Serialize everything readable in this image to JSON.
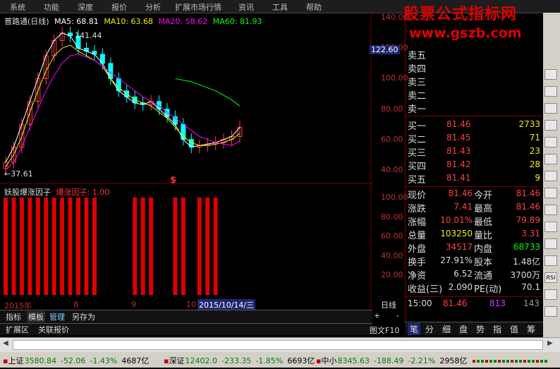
{
  "menu": [
    "系统",
    "功能",
    "深度",
    "报价",
    "分析",
    "扩展市场行情",
    "资讯",
    "工具",
    "帮助"
  ],
  "watermark": {
    "line1": "股票公式指标网",
    "line2": "www.gszb.com"
  },
  "chart": {
    "stock_name": "普路通(日线)",
    "ma5": "MA5: 68.81",
    "ma10": "MA10: 63.68",
    "ma20": "MA20: 58.62",
    "ma60": "MA60: 81.93",
    "high_label": "141.44",
    "low_label": "←37.61",
    "cursor_price": "122.60",
    "signal_mark": "$",
    "colors": {
      "ma5": "#ffffff",
      "ma10": "#f0f000",
      "ma20": "#ff00ff",
      "ma60": "#00ff00",
      "up": "#ff4040",
      "down": "#00ffff"
    }
  },
  "indicator": {
    "name": "妖股爆涨因子",
    "line": "爆涨因子: 1.00"
  },
  "x_axis": {
    "year": "2015年",
    "m8": "8",
    "m9": "9",
    "m10": "10",
    "date_box": "2015/10/14/三"
  },
  "chart_data": [
    {
      "type": "line",
      "title": "普路通(日线)",
      "y_ticks": [
        "140.00",
        "120.00",
        "100.00",
        "80.00",
        "60.00",
        "40.00"
      ],
      "ylim": [
        37.61,
        141.44
      ],
      "series": [
        {
          "name": "MA5",
          "values": [
            45,
            55,
            70,
            85,
            100,
            115,
            125,
            130,
            128,
            120,
            118,
            116,
            110,
            100,
            92,
            88,
            84,
            83,
            85,
            80,
            75,
            70,
            60,
            55,
            56,
            57,
            58,
            60,
            62,
            68
          ]
        },
        {
          "name": "MA10",
          "values": [
            42,
            50,
            62,
            78,
            92,
            105,
            115,
            120,
            122,
            118,
            115,
            112,
            108,
            100,
            94,
            90,
            86,
            84,
            82,
            78,
            74,
            68,
            62,
            58,
            56,
            56,
            57,
            58,
            60,
            64
          ]
        },
        {
          "name": "MA20",
          "values": [
            40,
            45,
            55,
            68,
            80,
            92,
            102,
            110,
            115,
            116,
            114,
            112,
            108,
            104,
            100,
            96,
            92,
            88,
            85,
            82,
            78,
            74,
            70,
            66,
            62,
            60,
            58,
            57,
            56,
            59
          ]
        },
        {
          "name": "MA60",
          "values": [
            null,
            null,
            null,
            null,
            null,
            null,
            null,
            null,
            null,
            null,
            null,
            null,
            null,
            null,
            null,
            null,
            null,
            null,
            null,
            null,
            null,
            100,
            99,
            98,
            96,
            94,
            92,
            89,
            86,
            82
          ]
        }
      ],
      "grid": false
    },
    {
      "type": "bar",
      "title": "妖股爆涨因子",
      "y_ticks": [
        "100.00",
        "80.00",
        "60.00",
        "40.00",
        "20.00"
      ],
      "ylim": [
        0,
        100
      ],
      "values": [
        1,
        1,
        1,
        1,
        1,
        1,
        1,
        1,
        1,
        1,
        1,
        1,
        0,
        0,
        0,
        0,
        1,
        1,
        1,
        0,
        0,
        1,
        1,
        0,
        1,
        1,
        1,
        0,
        0,
        0
      ]
    }
  ],
  "orderbook": {
    "sell": [
      "卖五",
      "卖四",
      "卖三",
      "卖二",
      "卖一"
    ],
    "buy": [
      {
        "label": "买一",
        "price": "81.46",
        "vol": "2733"
      },
      {
        "label": "买二",
        "price": "81.45",
        "vol": "71"
      },
      {
        "label": "买三",
        "price": "81.43",
        "vol": "23"
      },
      {
        "label": "买四",
        "price": "81.42",
        "vol": "28"
      },
      {
        "label": "买五",
        "price": "81.41",
        "vol": "9"
      }
    ]
  },
  "quote": [
    {
      "l1": "现价",
      "v1": "81.46",
      "c1": "#ff4040",
      "l2": "今开",
      "v2": "81.46",
      "c2": "#ff4040"
    },
    {
      "l1": "涨跌",
      "v1": "7.41",
      "c1": "#ff4040",
      "l2": "最高",
      "v2": "81.46",
      "c2": "#ff4040"
    },
    {
      "l1": "涨幅",
      "v1": "10.01%",
      "c1": "#ff4040",
      "l2": "最低",
      "v2": "79.89",
      "c2": "#ff4040"
    },
    {
      "l1": "总量",
      "v1": "103250",
      "c1": "#f0f000",
      "l2": "量比",
      "v2": "3.31",
      "c2": "#ff4040"
    },
    {
      "l1": "外盘",
      "v1": "34517",
      "c1": "#ff4040",
      "l2": "内盘",
      "v2": "68733",
      "c2": "#00ff00"
    },
    {
      "l1": "换手",
      "v1": "27.91%",
      "c1": "#dcdcdc",
      "l2": "股本",
      "v2": "1.48亿",
      "c2": "#dcdcdc"
    },
    {
      "l1": "净资",
      "v1": "6.52",
      "c1": "#dcdcdc",
      "l2": "流通",
      "v2": "3700万",
      "c2": "#dcdcdc"
    },
    {
      "l1": "收益(三)",
      "v1": "2.090",
      "c1": "#dcdcdc",
      "l2": "PE(动)",
      "v2": "70.1",
      "c2": "#dcdcdc"
    }
  ],
  "tick": {
    "time": "15:00",
    "price": "81.46",
    "vol": "813",
    "cnt": "143"
  },
  "bottom_tabs": [
    "指标",
    "模板",
    "管理",
    "另存为"
  ],
  "bottom_tabs2": [
    "扩展区",
    "关联报价"
  ],
  "period": "日线",
  "period_btn": "图文F10",
  "func_tabs": [
    "笔",
    "分",
    "细",
    "盘",
    "势",
    "指",
    "值",
    "筹"
  ],
  "status": [
    {
      "name": "上证",
      "val": "3580.84",
      "chg": "-52.06",
      "pct": "-1.43%",
      "amt": "4687亿"
    },
    {
      "name": "深证",
      "val": "12402.0",
      "chg": "-233.35",
      "pct": "-1.85%",
      "amt": "6693亿"
    },
    {
      "name": "中小",
      "val": "8345.63",
      "chg": "-188.49",
      "pct": "-2.21%",
      "amt": "2958亿"
    }
  ],
  "side_buttons": [
    "",
    "",
    "",
    "",
    "",
    "",
    "",
    "",
    "",
    "",
    "",
    "",
    "RSI",
    "",
    ""
  ]
}
